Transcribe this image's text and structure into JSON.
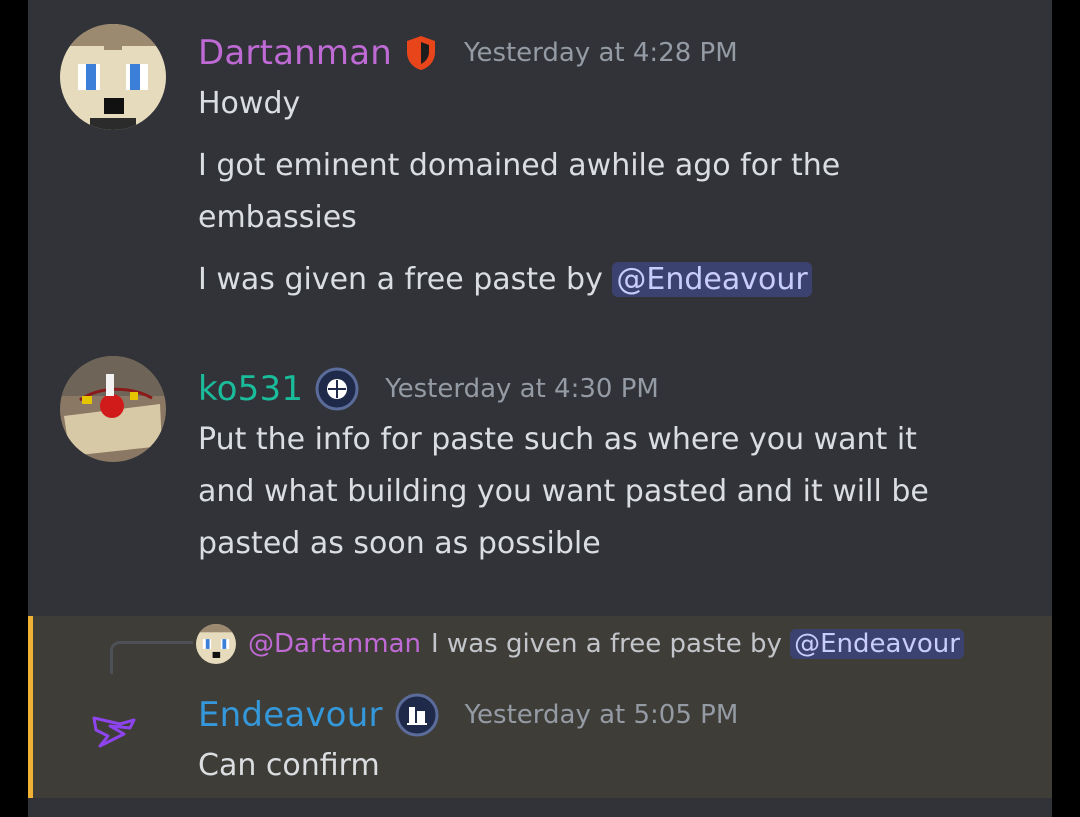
{
  "colors": {
    "background": "#313338",
    "reply_highlight": "#3f3d38",
    "reply_bar": "#f0b232",
    "dartanman": "#c06ad6",
    "ko531": "#1abc9c",
    "endeavour": "#3498db",
    "mention_bg": "#3c4270"
  },
  "messages": [
    {
      "author": "Dartanman",
      "badge": "shield-icon",
      "time": "Yesterday at 4:28 PM",
      "lines": [
        "Howdy",
        "I got eminent domained awhile ago for the",
        "embassies"
      ],
      "last_line_prefix": "I was given a free paste by ",
      "last_line_mention": "@Endeavour"
    },
    {
      "author": "ko531",
      "badge": "globe-badge-icon",
      "time": "Yesterday at 4:30 PM",
      "lines": [
        "Put the info for paste such as where you want it",
        "and what building you want pasted and it will be",
        "pasted as soon as possible"
      ]
    },
    {
      "author": "Endeavour",
      "badge": "building-badge-icon",
      "time": "Yesterday at 5:05 PM",
      "lines": [
        "Can confirm"
      ],
      "reply": {
        "mention": "@Dartanman",
        "text": "I was given a free paste by ",
        "mention2": "@Endeavour"
      }
    }
  ]
}
